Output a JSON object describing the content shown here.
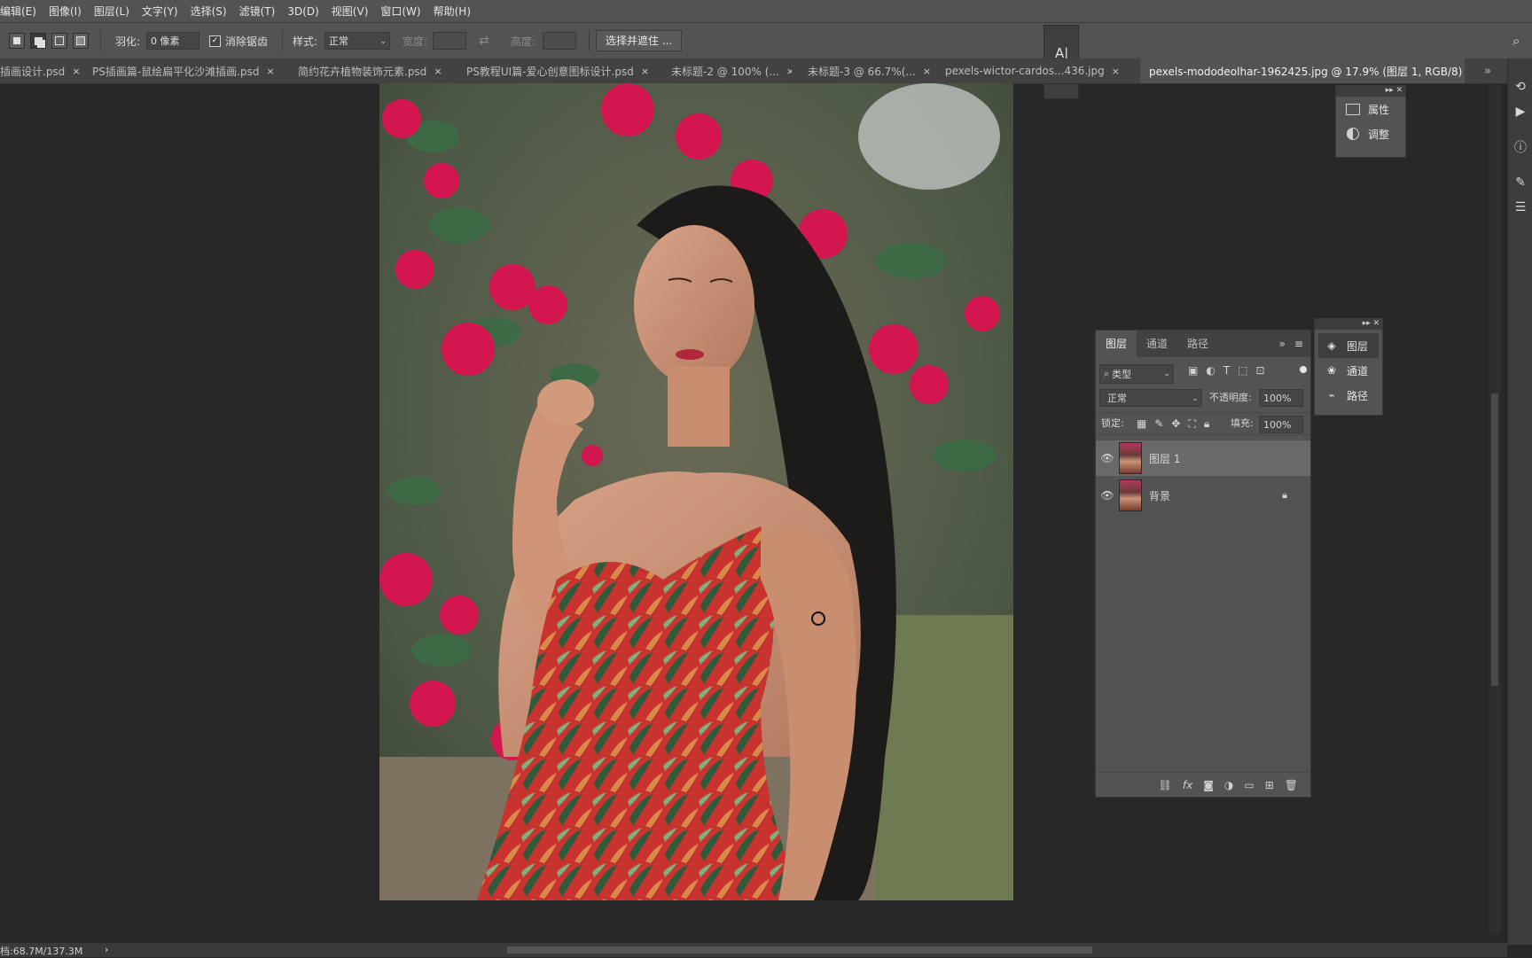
{
  "menu": [
    "编辑(E)",
    "图像(I)",
    "图层(L)",
    "文字(Y)",
    "选择(S)",
    "滤镜(T)",
    "3D(D)",
    "视图(V)",
    "窗口(W)",
    "帮助(H)"
  ],
  "options": {
    "feather_label": "羽化:",
    "feather_value": "0 像素",
    "antialias_label": "消除锯齿",
    "style_label": "样式:",
    "style_value": "正常",
    "width_label": "宽度:",
    "height_label": "高度:",
    "select_mask_button": "选择并遮住 ..."
  },
  "tabs": [
    {
      "label": "插画设计.psd",
      "active": false
    },
    {
      "label": "PS插画篇-鼠绘扁平化沙滩插画.psd",
      "active": false
    },
    {
      "label": "简约花卉植物装饰元素.psd",
      "active": false
    },
    {
      "label": "PS教程UI篇-爱心创意图标设计.psd",
      "active": false
    },
    {
      "label": "未标题-2 @ 100% (...",
      "active": false
    },
    {
      "label": "未标题-3 @ 66.7%(...",
      "active": false
    },
    {
      "label": "pexels-wictor-cardos...436.jpg",
      "active": false
    },
    {
      "label": "pexels-mododeolhar-1962425.jpg @ 17.9% (图层 1, RGB/8) *",
      "active": true
    }
  ],
  "tab_close_glyph": "×",
  "tabs_overflow": "»",
  "props_panel": {
    "items": [
      "属性",
      "调整"
    ]
  },
  "mini_panel": {
    "items": [
      "图层",
      "通道",
      "路径"
    ]
  },
  "layers_panel": {
    "tabs": [
      "图层",
      "通道",
      "路径"
    ],
    "filter_type": "类型",
    "blend_mode": "正常",
    "opacity_label": "不透明度:",
    "opacity_value": "100%",
    "lock_label": "锁定:",
    "fill_label": "填充:",
    "fill_value": "100%",
    "layers": [
      {
        "name": "图层 1",
        "selected": true,
        "locked": false
      },
      {
        "name": "背景",
        "selected": false,
        "locked": true
      }
    ],
    "footer_icons": [
      "link-icon",
      "fx-icon",
      "mask-icon",
      "adjustment-icon",
      "folder-icon",
      "new-layer-icon",
      "trash-icon"
    ],
    "fx_glyph": "fx"
  },
  "status": {
    "doc_size": "档:68.7M/137.3M"
  },
  "colors": {
    "ui_bg": "#535353",
    "canvas_bg": "#282828",
    "accent": "#3a3a3a"
  }
}
